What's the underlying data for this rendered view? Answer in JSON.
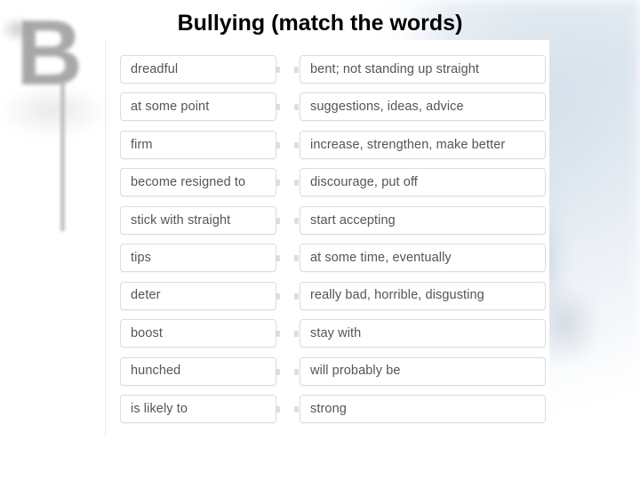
{
  "slide": {
    "title": "Bullying (match the words)",
    "background": {
      "watermark_letter": "B",
      "panel_bg_color": "#ffffff",
      "page_bg_color": "#ffffff",
      "text_color": "#555555",
      "border_color": "#dcdcdc",
      "title_color": "#000000"
    }
  },
  "exercise": {
    "type": "match-the-words",
    "rows": [
      {
        "term": "dreadful",
        "definition": "bent; not standing up straight"
      },
      {
        "term": "at some point",
        "definition": "suggestions, ideas, advice"
      },
      {
        "term": "firm",
        "definition": "increase, strengthen, make better"
      },
      {
        "term": "become resigned to",
        "definition": "discourage, put off"
      },
      {
        "term": "stick with straight",
        "definition": "start accepting"
      },
      {
        "term": "tips",
        "definition": "at some time, eventually"
      },
      {
        "term": "deter",
        "definition": "really bad, horrible, disgusting"
      },
      {
        "term": "boost",
        "definition": "stay with"
      },
      {
        "term": "hunched",
        "definition": "will probably be"
      },
      {
        "term": "is likely to",
        "definition": "strong"
      }
    ]
  }
}
